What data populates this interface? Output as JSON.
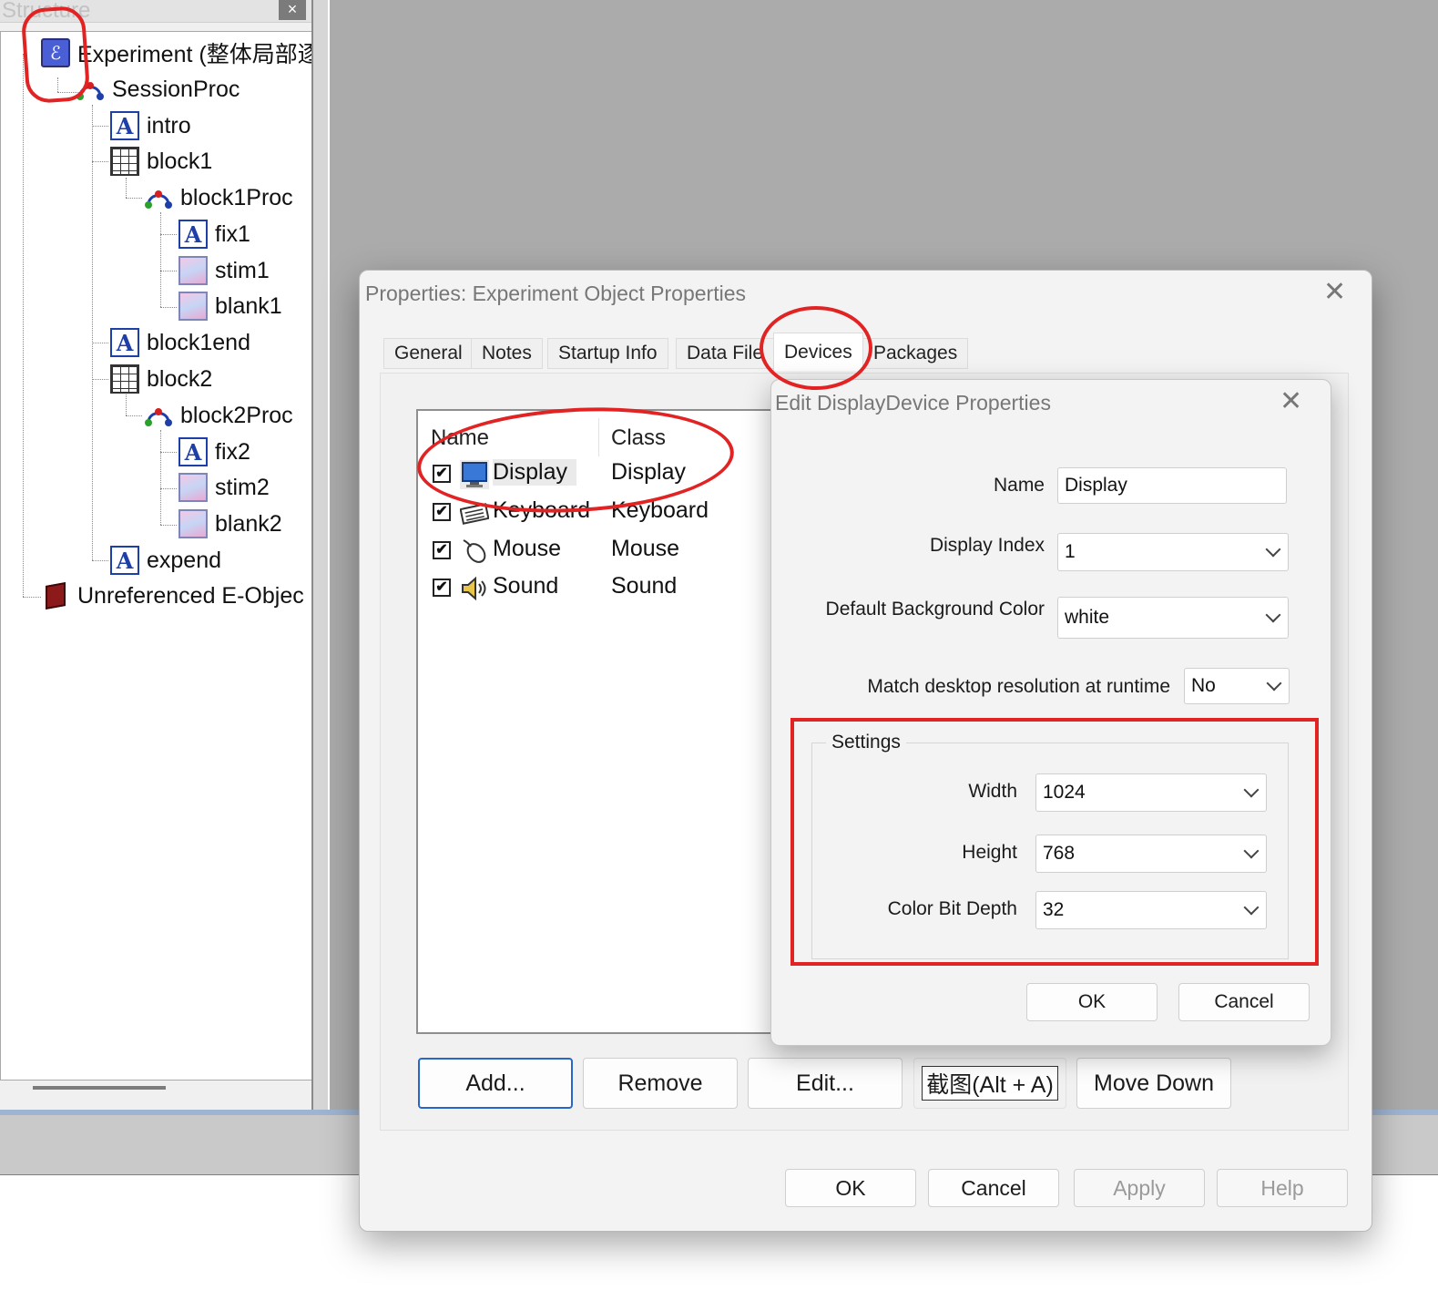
{
  "structure": {
    "title": "Structure",
    "close": "×",
    "tree": [
      {
        "label": "Experiment (整体局部逐",
        "icon": "experiment-icon"
      },
      {
        "label": "SessionProc",
        "icon": "procedure-icon"
      },
      {
        "label": "intro",
        "icon": "text-display-icon"
      },
      {
        "label": "block1",
        "icon": "list-icon"
      },
      {
        "label": "block1Proc",
        "icon": "procedure-icon"
      },
      {
        "label": "fix1",
        "icon": "text-display-icon"
      },
      {
        "label": "stim1",
        "icon": "slide-icon"
      },
      {
        "label": "blank1",
        "icon": "slide-icon"
      },
      {
        "label": "block1end",
        "icon": "text-display-icon"
      },
      {
        "label": "block2",
        "icon": "list-icon"
      },
      {
        "label": "block2Proc",
        "icon": "procedure-icon"
      },
      {
        "label": "fix2",
        "icon": "text-display-icon"
      },
      {
        "label": "stim2",
        "icon": "slide-icon"
      },
      {
        "label": "blank2",
        "icon": "slide-icon"
      },
      {
        "label": "expend",
        "icon": "text-display-icon"
      },
      {
        "label": "Unreferenced E-Objec",
        "icon": "unreferenced-objects-icon"
      }
    ]
  },
  "properties_dialog": {
    "title": "Properties: Experiment Object Properties",
    "close": "✕",
    "tabs": [
      "General",
      "Notes",
      "Startup Info",
      "Data File",
      "Devices",
      "Packages"
    ],
    "active_tab": "Devices",
    "columns": {
      "name": "Name",
      "class": "Class"
    },
    "devices": [
      {
        "checked": "✔",
        "name": "Display",
        "class": "Display",
        "icon": "display-icon"
      },
      {
        "checked": "✔",
        "name": "Keyboard",
        "class": "Keyboard",
        "icon": "keyboard-icon"
      },
      {
        "checked": "✔",
        "name": "Mouse",
        "class": "Mouse",
        "icon": "mouse-icon"
      },
      {
        "checked": "✔",
        "name": "Sound",
        "class": "Sound",
        "icon": "sound-icon"
      }
    ],
    "list_buttons": {
      "add": "Add...",
      "remove": "Remove",
      "edit": "Edit...",
      "screenshot": "截图(Alt + A)",
      "move_down": "Move Down"
    },
    "footer": {
      "ok": "OK",
      "cancel": "Cancel",
      "apply": "Apply",
      "help": "Help"
    }
  },
  "edit_dialog": {
    "title": "Edit DisplayDevice Properties",
    "close": "✕",
    "name": {
      "label": "Name",
      "value": "Display"
    },
    "display_index": {
      "label": "Display Index",
      "value": "1"
    },
    "background_color": {
      "label": "Default Background Color",
      "value": "white"
    },
    "match_resolution": {
      "label": "Match desktop resolution at runtime",
      "value": "No"
    },
    "settings": {
      "legend": "Settings",
      "width": {
        "label": "Width",
        "value": "1024"
      },
      "height": {
        "label": "Height",
        "value": "768"
      },
      "color_bit_depth": {
        "label": "Color Bit Depth",
        "value": "32"
      }
    },
    "ok": "OK",
    "cancel": "Cancel"
  },
  "colors": {
    "annotation": "#e12323",
    "accent": "#2667c9",
    "tree_icon": "#1e3ea8"
  }
}
